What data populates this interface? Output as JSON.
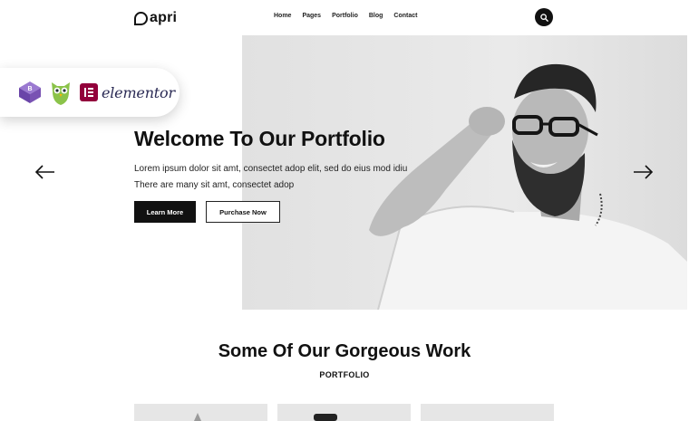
{
  "header": {
    "logo_text": "apri",
    "nav": [
      "Home",
      "Pages",
      "Portfolio",
      "Blog",
      "Contact"
    ]
  },
  "icons": {
    "search": "search-icon",
    "prev": "arrow-left-icon",
    "next": "arrow-right-icon",
    "bootstrap": "bootstrap-icon",
    "owl": "owl-icon",
    "elementor": "elementor-icon"
  },
  "badge": {
    "elementor_text": "elementor"
  },
  "hero": {
    "title": "Welcome To Our Portfolio",
    "text": "Lorem ipsum dolor sit amt, consectet adop elit, sed do eius mod idiu There are many sit amt, consectet adop",
    "learn_more": "Learn More",
    "purchase_now": "Purchase Now"
  },
  "gallery": {
    "title": "Some Of Our Gorgeous Work",
    "subtitle": "PORTFOLIO"
  },
  "colors": {
    "primary": "#111111",
    "elementor": "#92003b",
    "bootstrap": "#7952b3",
    "owl_green": "#8bc34a"
  }
}
